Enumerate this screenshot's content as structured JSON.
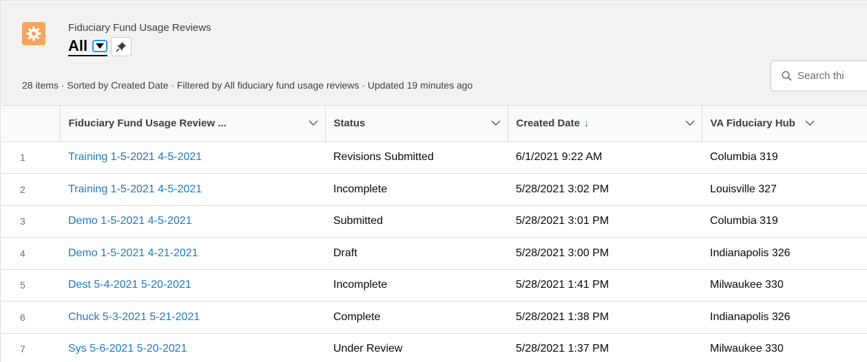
{
  "header": {
    "object_name": "Fiduciary Fund Usage Reviews",
    "view_name": "All",
    "meta": "28 items · Sorted by Created Date · Filtered by All fiduciary fund usage reviews · Updated 19 minutes ago",
    "search_placeholder": "Search thi",
    "icon_color": "#f2a461"
  },
  "table": {
    "columns": [
      {
        "label": "Fiduciary Fund Usage Review ..."
      },
      {
        "label": "Status"
      },
      {
        "label": "Created Date"
      },
      {
        "label": "VA Fiduciary Hub"
      }
    ],
    "rows": [
      {
        "num": "1",
        "name": "Training 1-5-2021 4-5-2021",
        "status": "Revisions Submitted",
        "created": "6/1/2021 9:22 AM",
        "hub": "Columbia 319"
      },
      {
        "num": "2",
        "name": "Training 1-5-2021 4-5-2021",
        "status": "Incomplete",
        "created": "5/28/2021 3:02 PM",
        "hub": "Louisville 327"
      },
      {
        "num": "3",
        "name": "Demo 1-5-2021 4-5-2021",
        "status": "Submitted",
        "created": "5/28/2021 3:01 PM",
        "hub": "Columbia 319"
      },
      {
        "num": "4",
        "name": "Demo 1-5-2021 4-21-2021",
        "status": "Draft",
        "created": "5/28/2021 3:00 PM",
        "hub": "Indianapolis 326"
      },
      {
        "num": "5",
        "name": "Dest 5-4-2021 5-20-2021",
        "status": "Incomplete",
        "created": "5/28/2021 1:41 PM",
        "hub": "Milwaukee 330"
      },
      {
        "num": "6",
        "name": "Chuck 5-3-2021 5-21-2021",
        "status": "Complete",
        "created": "5/28/2021 1:38 PM",
        "hub": "Indianapolis 326"
      },
      {
        "num": "7",
        "name": "Sys 5-6-2021 5-20-2021",
        "status": "Under Review",
        "created": "5/28/2021 1:37 PM",
        "hub": "Milwaukee 330"
      }
    ]
  }
}
